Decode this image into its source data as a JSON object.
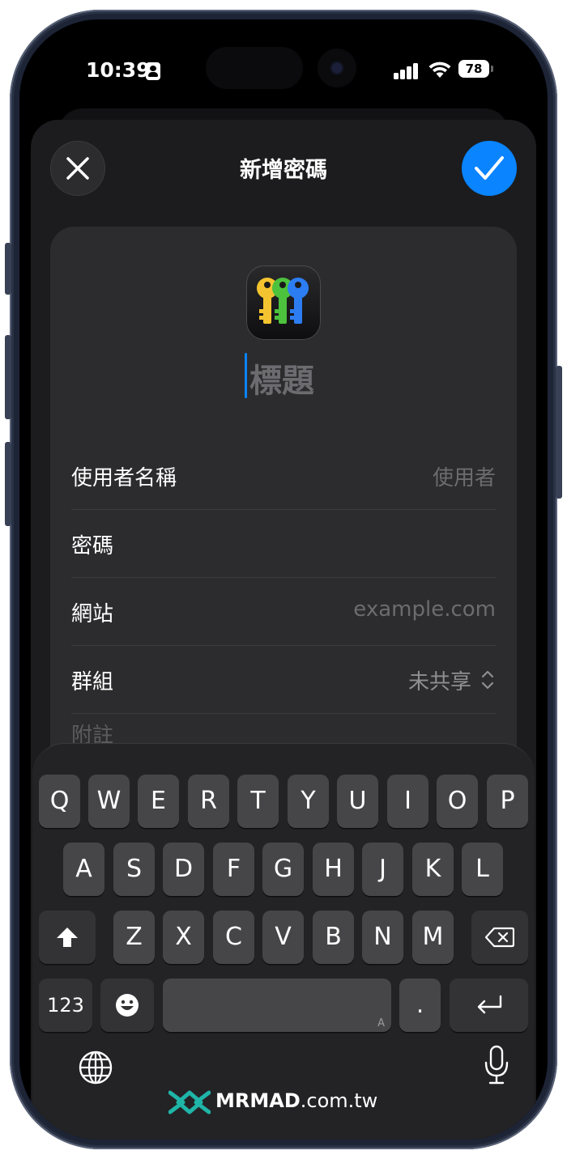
{
  "status_bar": {
    "time": "10:39",
    "battery": "78"
  },
  "header": {
    "title": "新增密碼"
  },
  "form": {
    "title_placeholder": "標題",
    "rows": [
      {
        "label": "使用者名稱",
        "value": "使用者"
      },
      {
        "label": "密碼",
        "value": ""
      },
      {
        "label": "網站",
        "value": "example.com"
      },
      {
        "label": "群組",
        "value": "未共享"
      }
    ],
    "notes_placeholder": "附註"
  },
  "keyboard": {
    "row1": [
      "Q",
      "W",
      "E",
      "R",
      "T",
      "Y",
      "U",
      "I",
      "O",
      "P"
    ],
    "row2": [
      "A",
      "S",
      "D",
      "F",
      "G",
      "H",
      "J",
      "K",
      "L"
    ],
    "row3": [
      "Z",
      "X",
      "C",
      "V",
      "B",
      "N",
      "M"
    ],
    "numbers_label": "123",
    "space_hint": "A",
    "period_label": "."
  },
  "watermark": {
    "brand": "MRMAD",
    "domain": ".com.tw"
  },
  "colors": {
    "accent": "#0a84ff",
    "sheet_bg": "#1c1c1e",
    "card_bg": "#2c2c2e",
    "key_bg": "#464648"
  }
}
